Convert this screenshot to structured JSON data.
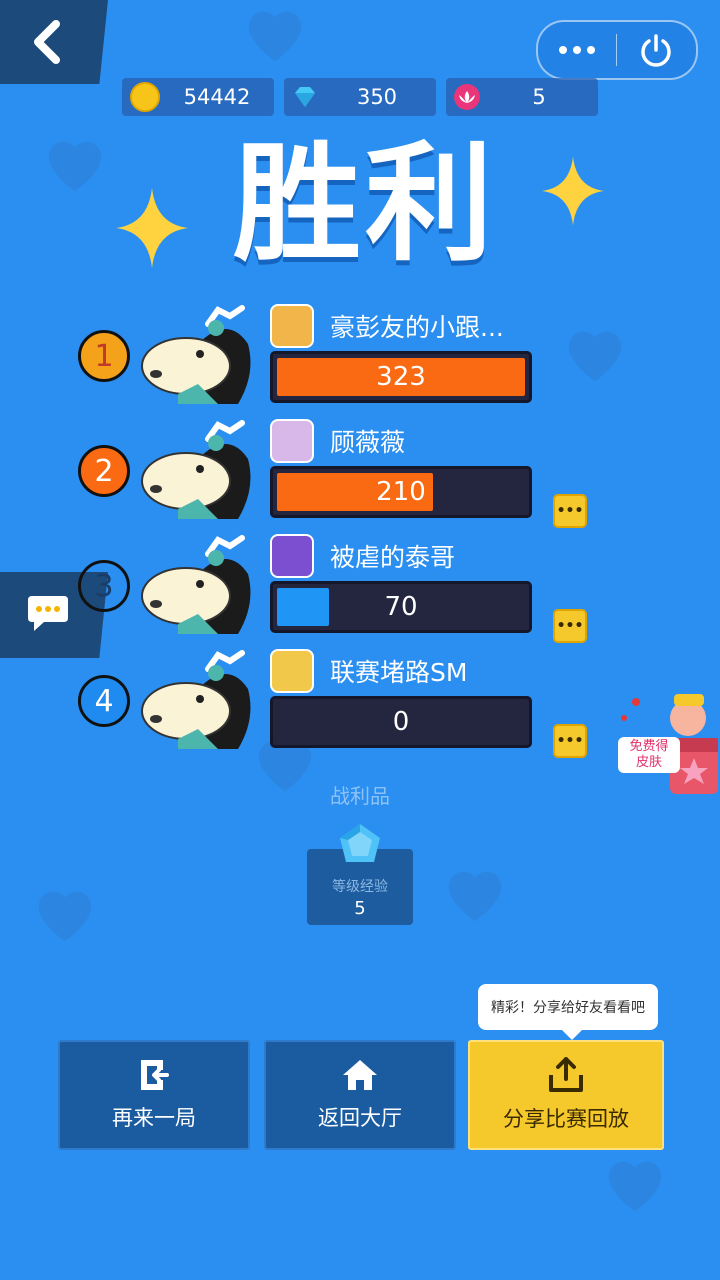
{
  "colors": {
    "background": "#2a8ff0",
    "bar_orange": "#f96a12",
    "bar_blue": "#1f95f5",
    "gold": "#f5c92b"
  },
  "resources": [
    {
      "icon": "gold-coin-icon",
      "value": "54442"
    },
    {
      "icon": "diamond-icon",
      "value": "350"
    },
    {
      "icon": "lotus-icon",
      "value": "5"
    }
  ],
  "title": "胜利",
  "players": [
    {
      "rank": "1",
      "rank_style": "medal",
      "name": "豪彭友的小跟...",
      "score": "323",
      "fill_fraction": 1.0,
      "color": "#f96a12",
      "show_more": false
    },
    {
      "rank": "2",
      "rank_style": "orange",
      "name": "顾薇薇",
      "score": "210",
      "fill_fraction": 0.63,
      "color": "#f96a12",
      "show_more": true
    },
    {
      "rank": "3",
      "rank_style": "dark",
      "name": "被虐的泰哥",
      "score": "70",
      "fill_fraction": 0.21,
      "color": "#1f95f5",
      "show_more": true
    },
    {
      "rank": "4",
      "rank_style": "blue",
      "name": "联赛堵路SM",
      "score": "0",
      "fill_fraction": 0.0,
      "color": "#1f95f5",
      "show_more": true
    }
  ],
  "loot": {
    "label": "战利品",
    "item_name": "等级经验",
    "item_value": "5"
  },
  "promo": {
    "line1": "免费得",
    "line2": "皮肤"
  },
  "tooltip": "精彩！分享给好友看看吧",
  "buttons": {
    "replay": "再来一局",
    "lobby": "返回大厅",
    "share": "分享比赛回放"
  }
}
